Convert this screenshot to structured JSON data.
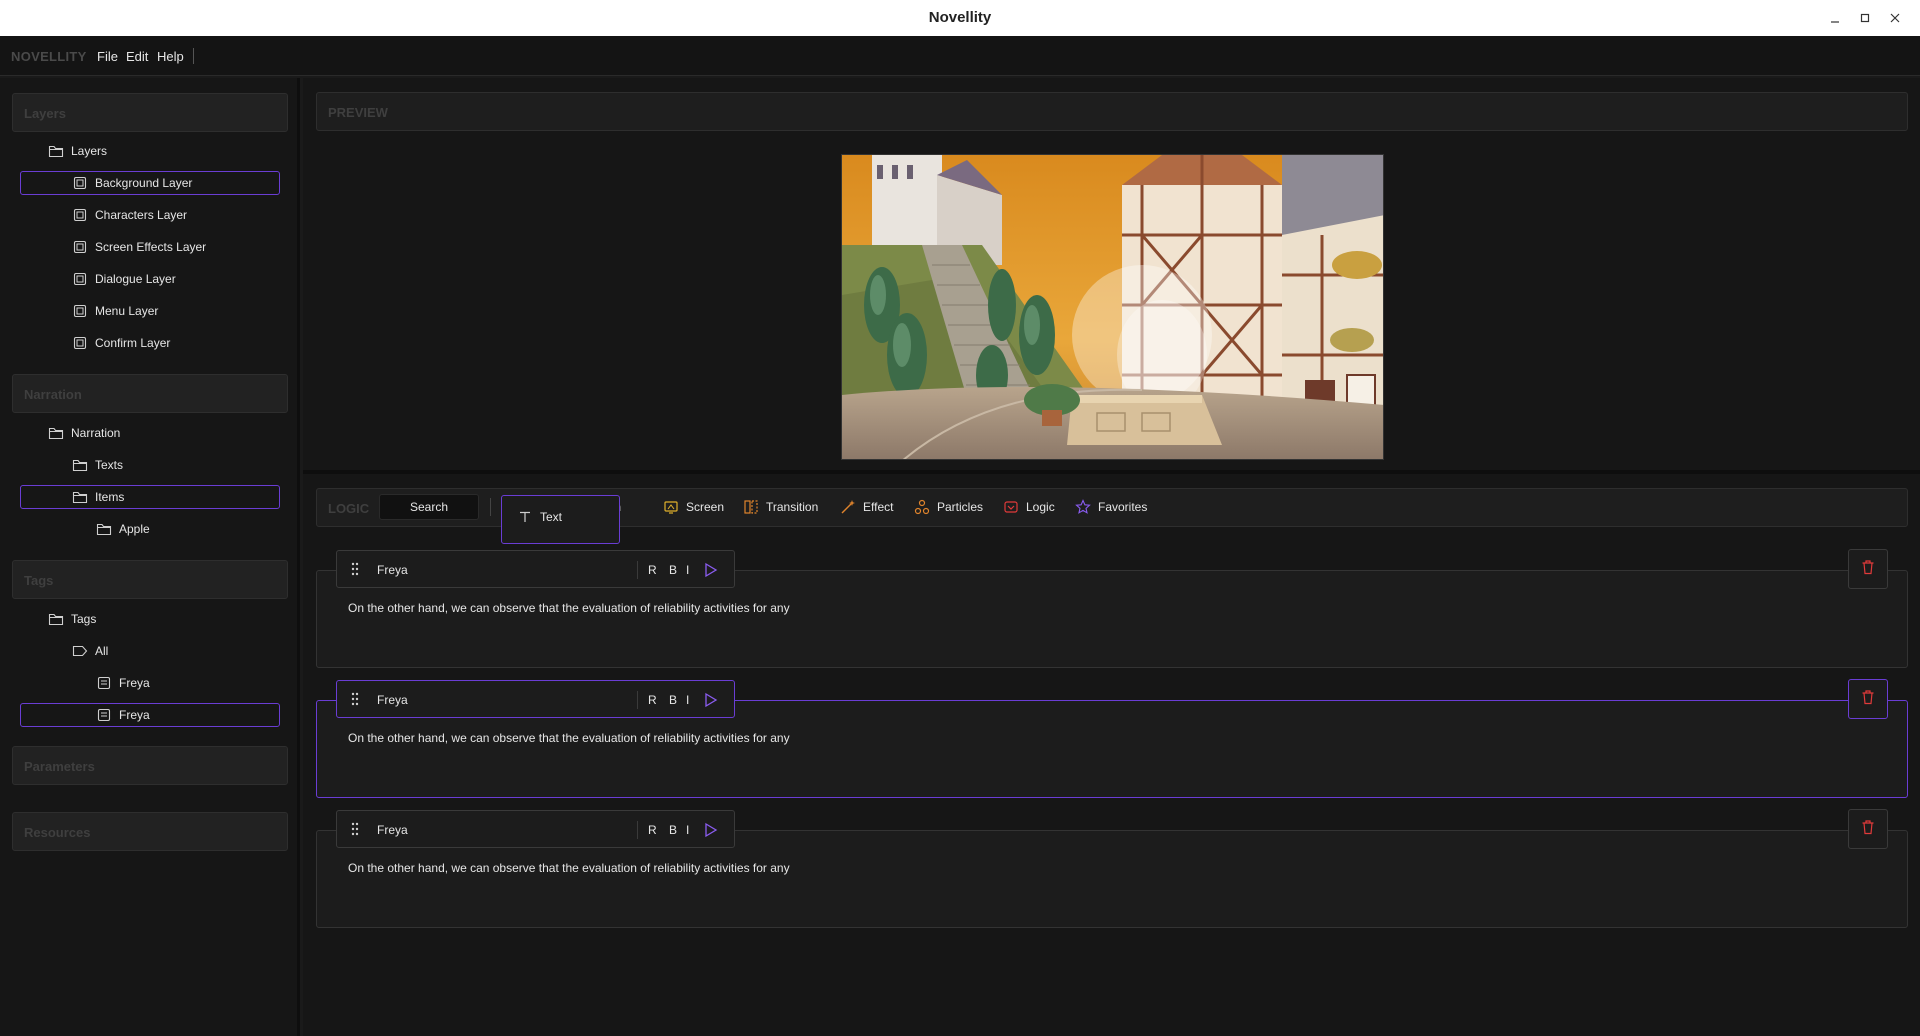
{
  "window": {
    "title": "Novellity"
  },
  "menubar": {
    "brand": "NOVELLITY",
    "items": [
      "File",
      "Edit",
      "Help"
    ]
  },
  "left": {
    "layers_header": "Layers",
    "layers_root": "Layers",
    "layers": [
      "Background Layer",
      "Characters Layer",
      "Screen Effects Layer",
      "Dialogue Layer",
      "Menu Layer",
      "Confirm Layer"
    ],
    "narration_header": "Narration",
    "narration_root": "Narration",
    "narration_texts": "Texts",
    "narration_items": "Items",
    "narration_apple": "Apple",
    "tags_header": "Tags",
    "tags_root": "Tags",
    "tags_all": "All",
    "tags_freya_1": "Freya",
    "tags_freya_2": "Freya",
    "parameters_header": "Parameters",
    "resources_header": "Resources"
  },
  "preview": {
    "header": "PREVIEW"
  },
  "logic": {
    "label": "LOGIC",
    "search": "Search",
    "partial_tool": "ation",
    "tools": [
      "Screen",
      "Transition",
      "Effect",
      "Particles",
      "Logic",
      "Favorites"
    ],
    "popup_item": "Text"
  },
  "dialogues": [
    {
      "character": "Freya",
      "r": "R",
      "b": "B",
      "i": "I",
      "text": "On the other hand, we can observe that the evaluation of reliability activities for any"
    },
    {
      "character": "Freya",
      "r": "R",
      "b": "B",
      "i": "I",
      "text": "On the other hand, we can observe that the evaluation of reliability activities for any"
    },
    {
      "character": "Freya",
      "r": "R",
      "b": "B",
      "i": "I",
      "text": "On the other hand, we can observe that the evaluation of reliability activities for any"
    }
  ],
  "colors": {
    "accent": "#6a3dd4",
    "danger": "#e03a3a",
    "tool_orange": "#e0842c"
  },
  "icons": [
    "minimize-icon",
    "maximize-icon",
    "close-icon",
    "folder-icon",
    "layer-icon",
    "tag-icon",
    "note-icon",
    "text-icon",
    "screen-icon",
    "transition-icon",
    "effect-icon",
    "particles-icon",
    "logic-icon",
    "favorites-icon",
    "drag-handle-icon",
    "play-icon",
    "trash-icon"
  ]
}
